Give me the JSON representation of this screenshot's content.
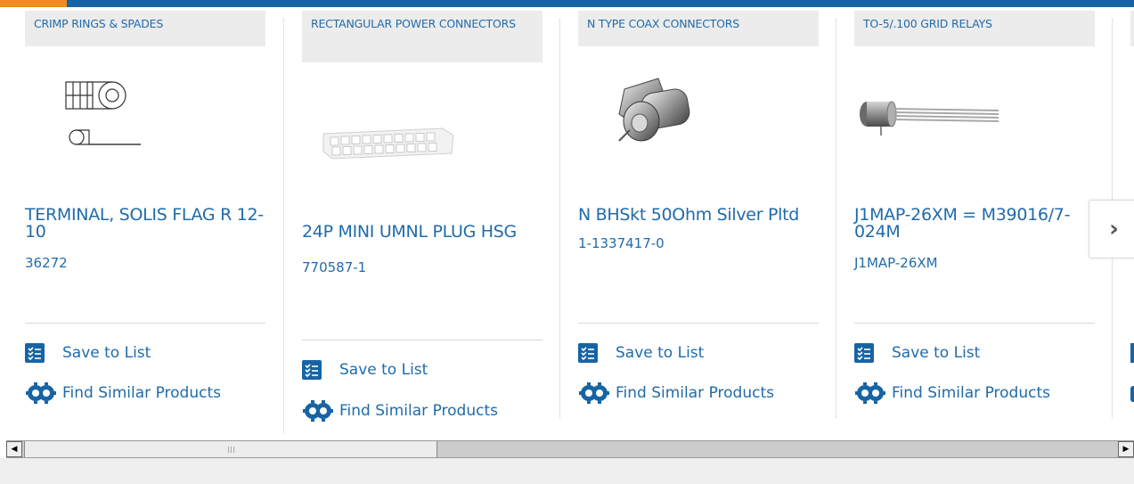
{
  "colors": {
    "brand_blue": "#1764a4",
    "accent_orange": "#f28c1e",
    "link_blue": "#1f6bab"
  },
  "cards": [
    {
      "category": "CRIMP RINGS & SPADES",
      "title": "TERMINAL, SOLIS FLAG R 12-10",
      "part_number": "36272",
      "save_label": "Save to List",
      "similar_label": "Find Similar Products"
    },
    {
      "category": "RECTANGULAR POWER CONNECTORS",
      "title": "24P MINI UMNL PLUG HSG",
      "part_number": "770587-1",
      "save_label": "Save to List",
      "similar_label": "Find Similar Products"
    },
    {
      "category": "N TYPE COAX CONNECTORS",
      "title": "N BHSkt 50Ohm Silver Pltd",
      "part_number": "1-1337417-0",
      "save_label": "Save to List",
      "similar_label": "Find Similar Products"
    },
    {
      "category": "TO-5/.100 GRID RELAYS",
      "title": "J1MAP-26XM = M39016/7-024M",
      "part_number": "J1MAP-26XM",
      "save_label": "Save to List",
      "similar_label": "Find Similar Products"
    }
  ],
  "icons": {
    "next": "chevron-right-icon",
    "list": "checklist-icon",
    "similar": "gears-icon",
    "scroll_left": "arrow-left-icon",
    "scroll_right": "arrow-right-icon"
  },
  "glyphs": {
    "next": "›",
    "scroll_left": "◀",
    "scroll_right": "▶"
  }
}
